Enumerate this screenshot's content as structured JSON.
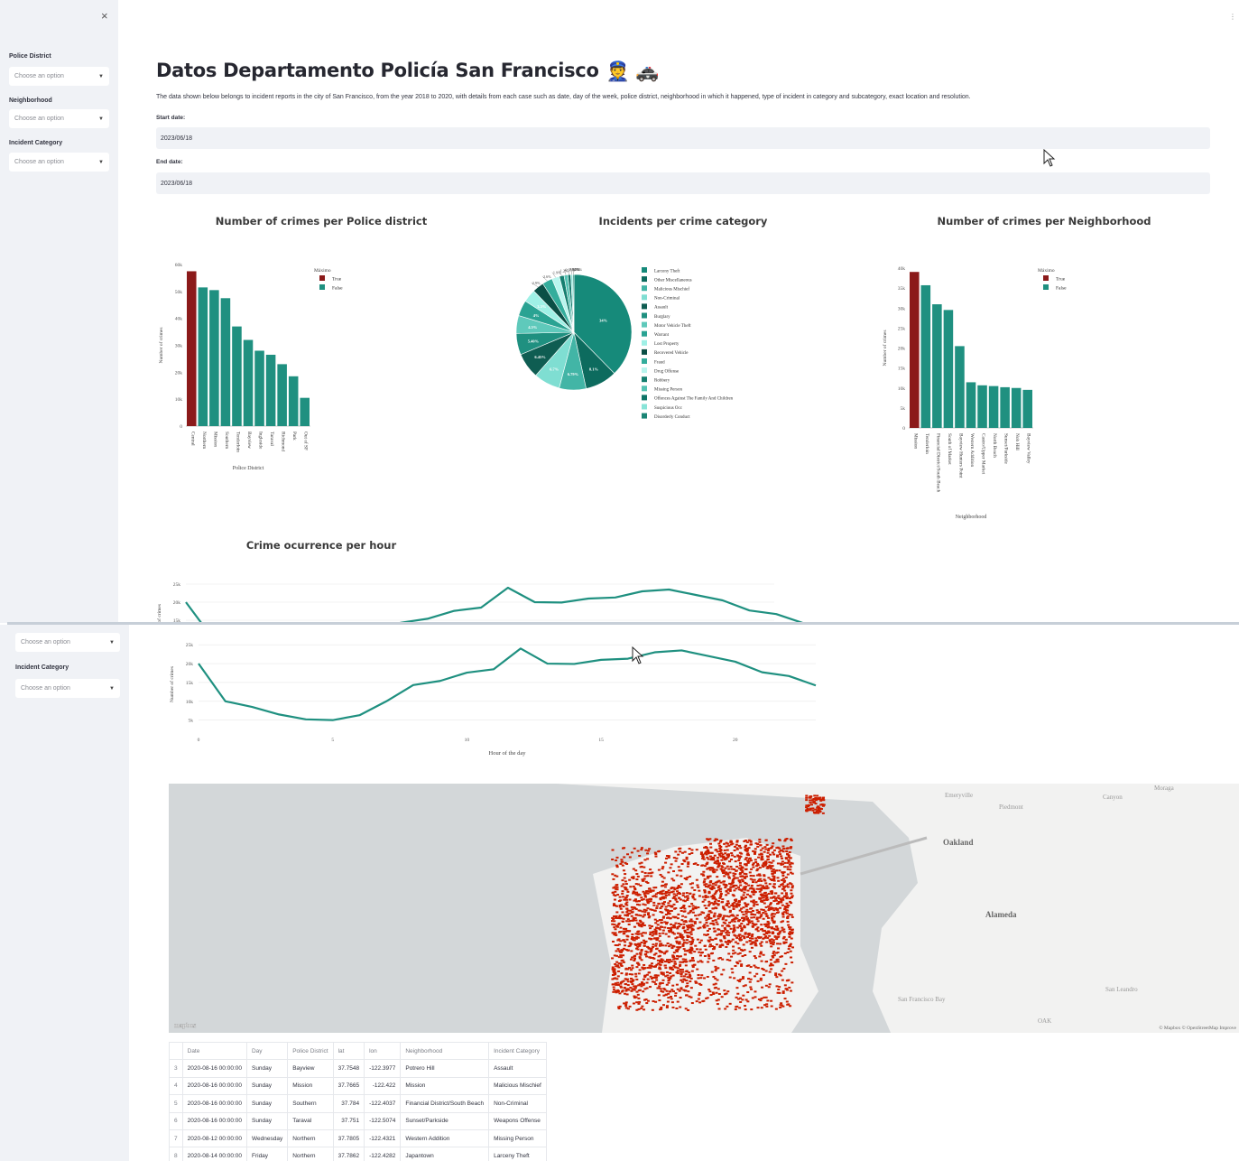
{
  "sidebar": {
    "close": "×",
    "filters": [
      {
        "label": "Police District",
        "placeholder": "Choose an option"
      },
      {
        "label": "Neighborhood",
        "placeholder": "Choose an option"
      },
      {
        "label": "Incident Category",
        "placeholder": "Choose an option"
      }
    ]
  },
  "menu_icon": "⋮",
  "header": {
    "title": "Datos Departamento Policía San Francisco",
    "emoji": "👮 🚓",
    "description": "The data shown below belongs to incident reports in the city of San Francisco, from the year 2018 to 2020, with details from each case such as date, day of the week, police district, neighborhood in which it happened, type of incident in category and subcategory, exact location and resolution."
  },
  "dates": {
    "start_label": "Start date:",
    "start_value": "2023/06/18",
    "end_label": "End date:",
    "end_value": "2023/06/18"
  },
  "colors": {
    "accent": "#1f9080",
    "max": "#8b1a1a",
    "map_points": "#cc1f00",
    "sidebar": "#f0f2f6"
  },
  "chart_data": [
    {
      "type": "bar",
      "title": "Number of crimes per Police district",
      "xlabel": "Police District",
      "ylabel": "Number of crimes",
      "legend": {
        "title": "Máximo",
        "entries": [
          "True",
          "False"
        ],
        "placement": "top-right"
      },
      "categories": [
        "Central",
        "Northern",
        "Mission",
        "Southern",
        "Tenderloin",
        "Bayview",
        "Ingleside",
        "Taraval",
        "Richmond",
        "Park",
        "Out of SF"
      ],
      "values": [
        57500,
        51500,
        50500,
        47500,
        37000,
        32000,
        28000,
        26500,
        23000,
        18500,
        10500
      ],
      "maximo": [
        true,
        false,
        false,
        false,
        false,
        false,
        false,
        false,
        false,
        false,
        false
      ],
      "yticks": [
        "0",
        "10k",
        "20k",
        "30k",
        "40k",
        "50k",
        "60k"
      ],
      "ylim": [
        0,
        60000
      ]
    },
    {
      "type": "pie",
      "title": "Incidents per crime category",
      "categories": [
        "Larceny Theft",
        "Other Miscellaneous",
        "Malicious Mischief",
        "Non-Criminal",
        "Assault",
        "Burglary",
        "Motor Vehicle Theft",
        "Warrant",
        "Lost Property",
        "Recovered Vehicle",
        "Fraud",
        "Drug Offense",
        "Robbery",
        "Missing Person",
        "Offences Against The Family And Children",
        "Suspicious Occ",
        "Disorderly Conduct"
      ],
      "values": [
        34,
        8.1,
        6.79,
        6.7,
        6.45,
        5.4,
        4.5,
        4,
        3.3,
        2.9,
        2.6,
        1.9,
        1.2,
        0.95,
        0.74,
        0.5,
        0.3
      ],
      "slice_labels": [
        "34%",
        "8.1%",
        "6.79%",
        "6.7%",
        "6.45%",
        "5.40%",
        "4.5%",
        "4%",
        "3.3%",
        "2.9%",
        "2.6%",
        "1.9%",
        "1.2%",
        "0.95%",
        "0.74%",
        "0.5%",
        "0.3%"
      ]
    },
    {
      "type": "bar",
      "title": "Number of crimes per Neighborhood",
      "xlabel": "Neighborhood",
      "ylabel": "Number of crimes",
      "legend": {
        "title": "Máximo",
        "entries": [
          "True",
          "False"
        ],
        "placement": "top-right"
      },
      "categories": [
        "Mission",
        "Tenderloin",
        "Financial District/South Beach",
        "South of Market",
        "Bayview Hunters Point",
        "Western Addition",
        "Castro/Upper Market",
        "North Beach",
        "Sunset/Parkside",
        "Nob Hill",
        "Bayview Valley"
      ],
      "values": [
        41000,
        37500,
        32500,
        31000,
        21500,
        12000,
        11200,
        11000,
        10700,
        10500,
        10000
      ],
      "maximo": [
        true,
        false,
        false,
        false,
        false,
        false,
        false,
        false,
        false,
        false,
        false
      ],
      "yticks": [
        "0",
        "5k",
        "10k",
        "15k",
        "20k",
        "25k",
        "30k",
        "35k",
        "40k"
      ],
      "ylim": [
        0,
        42000
      ]
    },
    {
      "type": "line",
      "title": "Crime ocurrence per hour",
      "xlabel": "Hour of the day",
      "ylabel": "Number of crimes",
      "x": [
        0,
        1,
        2,
        3,
        4,
        5,
        6,
        7,
        8,
        9,
        10,
        11,
        12,
        13,
        14,
        15,
        16,
        17,
        18,
        19,
        20,
        21,
        22,
        23
      ],
      "values": [
        20000,
        10000,
        8500,
        6500,
        5200,
        5000,
        6300,
        10000,
        14300,
        15400,
        17600,
        18500,
        24000,
        20000,
        19900,
        21000,
        21300,
        23000,
        23500,
        22000,
        20500,
        17700,
        16700,
        14200
      ],
      "xticks": [
        "0",
        "5",
        "10",
        "15",
        "20"
      ],
      "yticks": [
        "5k",
        "10k",
        "15k",
        "20k",
        "25k"
      ],
      "ylim": [
        3000,
        26000
      ]
    }
  ],
  "map": {
    "attribution": "© Mapbox © OpenStreetMap Improve",
    "logo": "mapbox",
    "labels": [
      "Emeryville",
      "Piedmont",
      "Oakland",
      "Alameda",
      "San Leandro",
      "Moraga",
      "Canyon",
      "San Francisco Bay",
      "OAK"
    ]
  },
  "table": {
    "columns": [
      "",
      "Date",
      "Day",
      "Police District",
      "lat",
      "lon",
      "Neighborhood",
      "Incident Category"
    ],
    "rows": [
      [
        "3",
        "2020-08-16 00:00:00",
        "Sunday",
        "Bayview",
        "37.7548",
        "-122.3977",
        "Potrero Hill",
        "Assault"
      ],
      [
        "4",
        "2020-08-16 00:00:00",
        "Sunday",
        "Mission",
        "37.7665",
        "-122.422",
        "Mission",
        "Malicious Mischief"
      ],
      [
        "5",
        "2020-08-16 00:00:00",
        "Sunday",
        "Southern",
        "37.784",
        "-122.4037",
        "Financial District/South Beach",
        "Non-Criminal"
      ],
      [
        "6",
        "2020-08-16 00:00:00",
        "Sunday",
        "Taraval",
        "37.751",
        "-122.5074",
        "Sunset/Parkside",
        "Weapons Offense"
      ],
      [
        "7",
        "2020-08-12 00:00:00",
        "Wednesday",
        "Northern",
        "37.7805",
        "-122.4321",
        "Western Addition",
        "Missing Person"
      ],
      [
        "8",
        "2020-08-14 00:00:00",
        "Friday",
        "Northern",
        "37.7862",
        "-122.4282",
        "Japantown",
        "Larceny Theft"
      ]
    ]
  }
}
